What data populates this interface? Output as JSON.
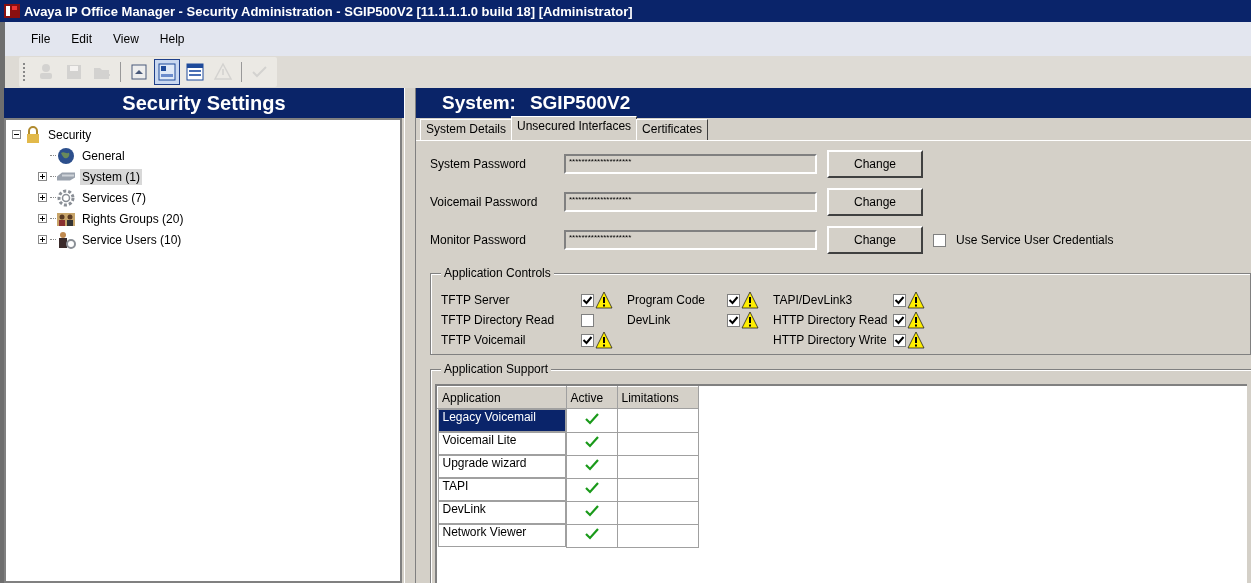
{
  "window": {
    "title": "Avaya IP Office Manager - Security Administration - SGIP500V2 [11.1.1.1.0 build 18] [Administrator]"
  },
  "menu": [
    "File",
    "Edit",
    "View",
    "Help"
  ],
  "toolbar": [
    [
      {
        "kind": "user",
        "disabled": true,
        "selected": false
      },
      {
        "kind": "save",
        "disabled": true,
        "selected": false
      },
      {
        "kind": "open",
        "disabled": true,
        "selected": false
      }
    ],
    [
      {
        "kind": "up",
        "disabled": false,
        "selected": false
      },
      {
        "kind": "panel",
        "disabled": false,
        "selected": true
      },
      {
        "kind": "list",
        "disabled": false,
        "selected": false
      },
      {
        "kind": "warning",
        "disabled": true,
        "selected": false
      }
    ],
    [
      {
        "kind": "check",
        "disabled": true,
        "selected": false
      }
    ]
  ],
  "sidebar": {
    "title": "Security Settings",
    "tree": [
      {
        "label": "Security",
        "kind": "lock",
        "expanded": true,
        "selected": false,
        "children": [
          {
            "label": "General",
            "kind": "globe",
            "selected": false
          },
          {
            "label": "System (1)",
            "kind": "device",
            "expanded": false,
            "selected": true
          },
          {
            "label": "Services (7)",
            "kind": "gear",
            "expanded": false,
            "selected": false
          },
          {
            "label": "Rights Groups (20)",
            "kind": "group",
            "expanded": false,
            "selected": false
          },
          {
            "label": "Service Users (10)",
            "kind": "user",
            "expanded": false,
            "selected": false
          }
        ]
      }
    ]
  },
  "header": {
    "label": "System:",
    "value": "SGIP500V2"
  },
  "tabs": [
    {
      "label": "System Details",
      "selected": false
    },
    {
      "label": "Unsecured Interfaces",
      "selected": true
    },
    {
      "label": "Certificates",
      "selected": false
    }
  ],
  "passwords": [
    {
      "label": "System Password",
      "value": "********************",
      "button": "Change"
    },
    {
      "label": "Voicemail Password",
      "value": "********************",
      "button": "Change"
    },
    {
      "label": "Monitor Password",
      "value": "********************",
      "button": "Change",
      "option": {
        "label": "Use Service User Credentials",
        "checked": false
      }
    }
  ],
  "application_controls": {
    "title": "Application Controls",
    "columns": [
      [
        {
          "label": "TFTP Server",
          "checked": true
        },
        {
          "label": "TFTP Directory Read",
          "checked": false
        },
        {
          "label": "TFTP Voicemail",
          "checked": true
        }
      ],
      [
        {
          "label": "Program Code",
          "checked": true
        },
        {
          "label": "DevLink",
          "checked": true
        }
      ],
      [
        {
          "label": "TAPI/DevLink3",
          "checked": true
        },
        {
          "label": "HTTP Directory Read",
          "checked": true
        },
        {
          "label": "HTTP Directory Write",
          "checked": true
        }
      ]
    ]
  },
  "application_support": {
    "title": "Application Support",
    "columns": [
      "Application",
      "Active",
      "Limitations"
    ],
    "rows": [
      {
        "application": "Legacy Voicemail",
        "active": true,
        "selected": true
      },
      {
        "application": "Voicemail Lite",
        "active": true,
        "selected": false
      },
      {
        "application": "Upgrade wizard",
        "active": true,
        "selected": false
      },
      {
        "application": "TAPI",
        "active": true,
        "selected": false
      },
      {
        "application": "DevLink",
        "active": true,
        "selected": false
      },
      {
        "application": "Network Viewer",
        "active": true,
        "selected": false
      }
    ]
  }
}
